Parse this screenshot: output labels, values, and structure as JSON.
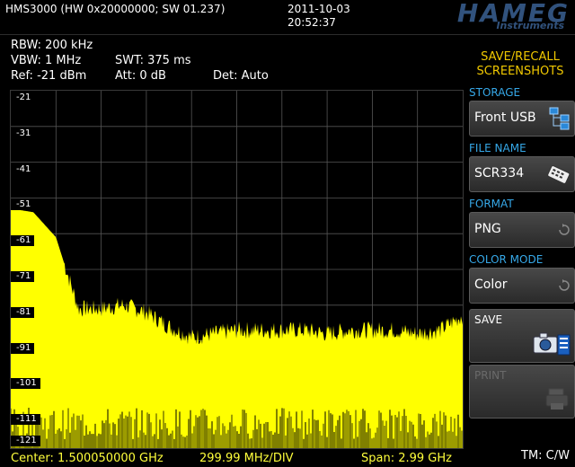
{
  "header": {
    "title": "HMS3000 (HW 0x20000000; SW 01.237)",
    "date": "2011-10-03",
    "time": "20:52:37",
    "brand": "HAMEG",
    "brand_sub": "Instruments"
  },
  "params": {
    "rbw": "RBW: 200 kHz",
    "vbw": "VBW: 1 MHz",
    "swt": "SWT: 375 ms",
    "ref": "Ref: -21 dBm",
    "att": "Att: 0 dB",
    "det": "Det: Auto"
  },
  "chart_data": {
    "type": "area",
    "ylim": [
      -121,
      -21
    ],
    "yticks": [
      "-21",
      "-31",
      "-41",
      "-51",
      "-61",
      "-71",
      "-81",
      "-91",
      "-101",
      "-111",
      "-121"
    ],
    "x_center": "Center: 1.500050000 GHz",
    "x_per_div": "299.99 MHz/DIV",
    "x_span": "Span: 2.99 GHz",
    "grid": true,
    "trace_color": "#ffff00",
    "series": [
      {
        "x_ghz": [
          0.005,
          0.15,
          0.3,
          0.45,
          0.6,
          0.75,
          0.9,
          1.05,
          1.2,
          1.35,
          1.5,
          1.65,
          1.8,
          1.95,
          2.1,
          2.25,
          2.4,
          2.55,
          2.7,
          2.85,
          2.995
        ],
        "values": [
          -54,
          -55,
          -62,
          -82,
          -82,
          -81,
          -83,
          -87,
          -90,
          -89,
          -88,
          -88,
          -88,
          -88,
          -89,
          -88,
          -88,
          -88,
          -89,
          -88,
          -84
        ]
      }
    ]
  },
  "footer": {
    "center": "Center: 1.500050000 GHz",
    "div": "299.99 MHz/DIV",
    "span": "Span: 2.99 GHz",
    "tm": "TM: C/W"
  },
  "menu": {
    "title_line1": "SAVE/RECALL",
    "title_line2": "SCREENSHOTS",
    "storage_label": "STORAGE",
    "storage_value": "Front USB",
    "filename_label": "FILE NAME",
    "filename_value": "SCR334",
    "format_label": "FORMAT",
    "format_value": "PNG",
    "colormode_label": "COLOR MODE",
    "colormode_value": "Color",
    "save_label": "SAVE",
    "print_label": "PRINT",
    "icons": [
      "folder-tree-icon",
      "keyboard-icon",
      "cycle-icon",
      "camera-icon",
      "printer-icon"
    ]
  }
}
